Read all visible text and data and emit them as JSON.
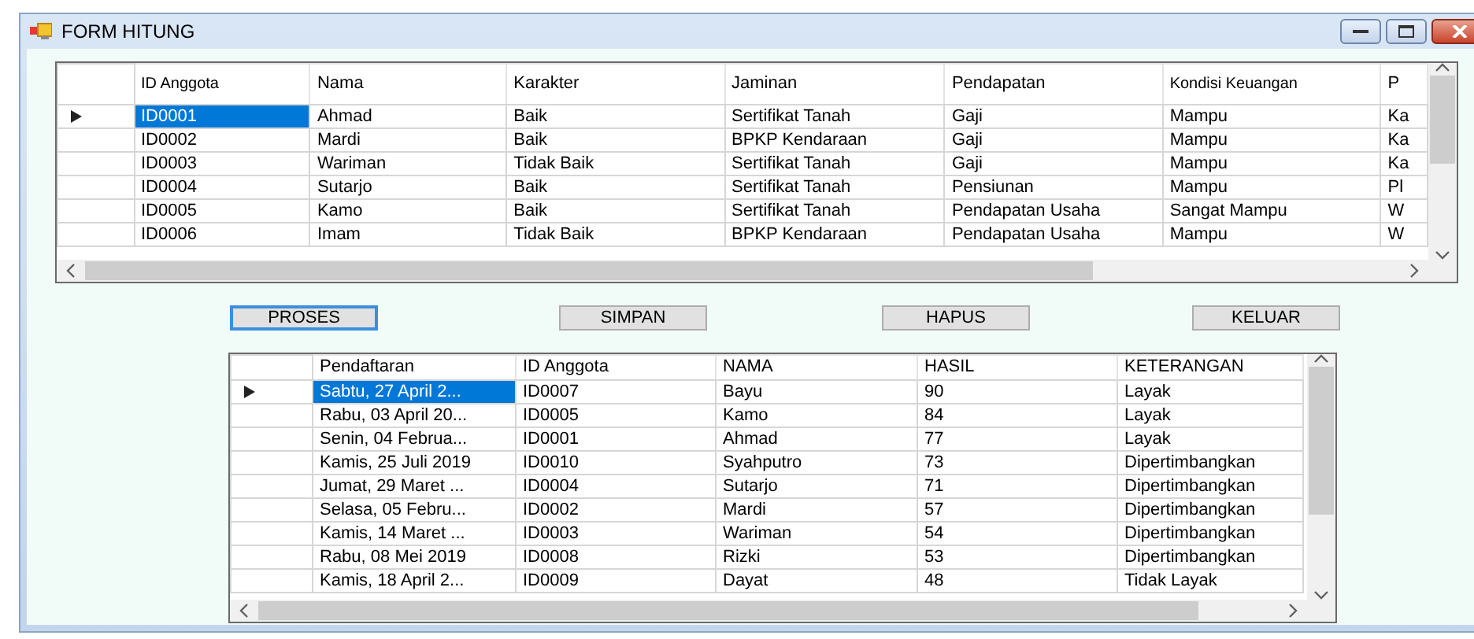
{
  "window": {
    "title": "FORM HITUNG"
  },
  "grid_top": {
    "columns": [
      "ID Anggota",
      "Nama",
      "Karakter",
      "Jaminan",
      "Pendapatan",
      "Kondisi Keuangan",
      "P"
    ],
    "rows": [
      {
        "selected": true,
        "cells": [
          "ID0001",
          "Ahmad",
          "Baik",
          "Sertifikat Tanah",
          "Gaji",
          "Mampu",
          "Ka"
        ]
      },
      {
        "selected": false,
        "cells": [
          "ID0002",
          "Mardi",
          "Baik",
          "BPKP Kendaraan",
          "Gaji",
          "Mampu",
          "Ka"
        ]
      },
      {
        "selected": false,
        "cells": [
          "ID0003",
          "Wariman",
          "Tidak Baik",
          "Sertifikat Tanah",
          "Gaji",
          "Mampu",
          "Ka"
        ]
      },
      {
        "selected": false,
        "cells": [
          "ID0004",
          "Sutarjo",
          "Baik",
          "Sertifikat Tanah",
          "Pensiunan",
          "Mampu",
          "Pl"
        ]
      },
      {
        "selected": false,
        "cells": [
          "ID0005",
          "Kamo",
          "Baik",
          "Sertifikat Tanah",
          "Pendapatan Usaha",
          "Sangat Mampu",
          "W"
        ]
      },
      {
        "selected": false,
        "cells": [
          "ID0006",
          "Imam",
          "Tidak Baik",
          "BPKP Kendaraan",
          "Pendapatan Usaha",
          "Mampu",
          "W"
        ]
      }
    ]
  },
  "buttons": [
    {
      "label": "PROSES",
      "selected": true
    },
    {
      "label": "SIMPAN",
      "selected": false
    },
    {
      "label": "HAPUS",
      "selected": false
    },
    {
      "label": "KELUAR",
      "selected": false
    }
  ],
  "grid_bottom": {
    "columns": [
      "Pendaftaran",
      "ID Anggota",
      "NAMA",
      "HASIL",
      "KETERANGAN"
    ],
    "rows": [
      {
        "selected": true,
        "cells": [
          "Sabtu, 27 April 2...",
          "ID0007",
          "Bayu",
          "90",
          "Layak"
        ]
      },
      {
        "selected": false,
        "cells": [
          "Rabu, 03 April 20...",
          "ID0005",
          "Kamo",
          "84",
          "Layak"
        ]
      },
      {
        "selected": false,
        "cells": [
          "Senin, 04 Februa...",
          "ID0001",
          "Ahmad",
          "77",
          "Layak"
        ]
      },
      {
        "selected": false,
        "cells": [
          "Kamis, 25 Juli 2019",
          "ID0010",
          "Syahputro",
          "73",
          "Dipertimbangkan"
        ]
      },
      {
        "selected": false,
        "cells": [
          "Jumat, 29 Maret ...",
          "ID0004",
          "Sutarjo",
          "71",
          "Dipertimbangkan"
        ]
      },
      {
        "selected": false,
        "cells": [
          "Selasa, 05 Febru...",
          "ID0002",
          "Mardi",
          "57",
          "Dipertimbangkan"
        ]
      },
      {
        "selected": false,
        "cells": [
          "Kamis, 14 Maret ...",
          "ID0003",
          "Wariman",
          "54",
          "Dipertimbangkan"
        ]
      },
      {
        "selected": false,
        "cells": [
          "Rabu, 08 Mei 2019",
          "ID0008",
          "Rizki",
          "53",
          "Dipertimbangkan"
        ]
      },
      {
        "selected": false,
        "cells": [
          "Kamis, 18 April 2...",
          "ID0009",
          "Dayat",
          "48",
          "Tidak Layak"
        ]
      }
    ]
  }
}
